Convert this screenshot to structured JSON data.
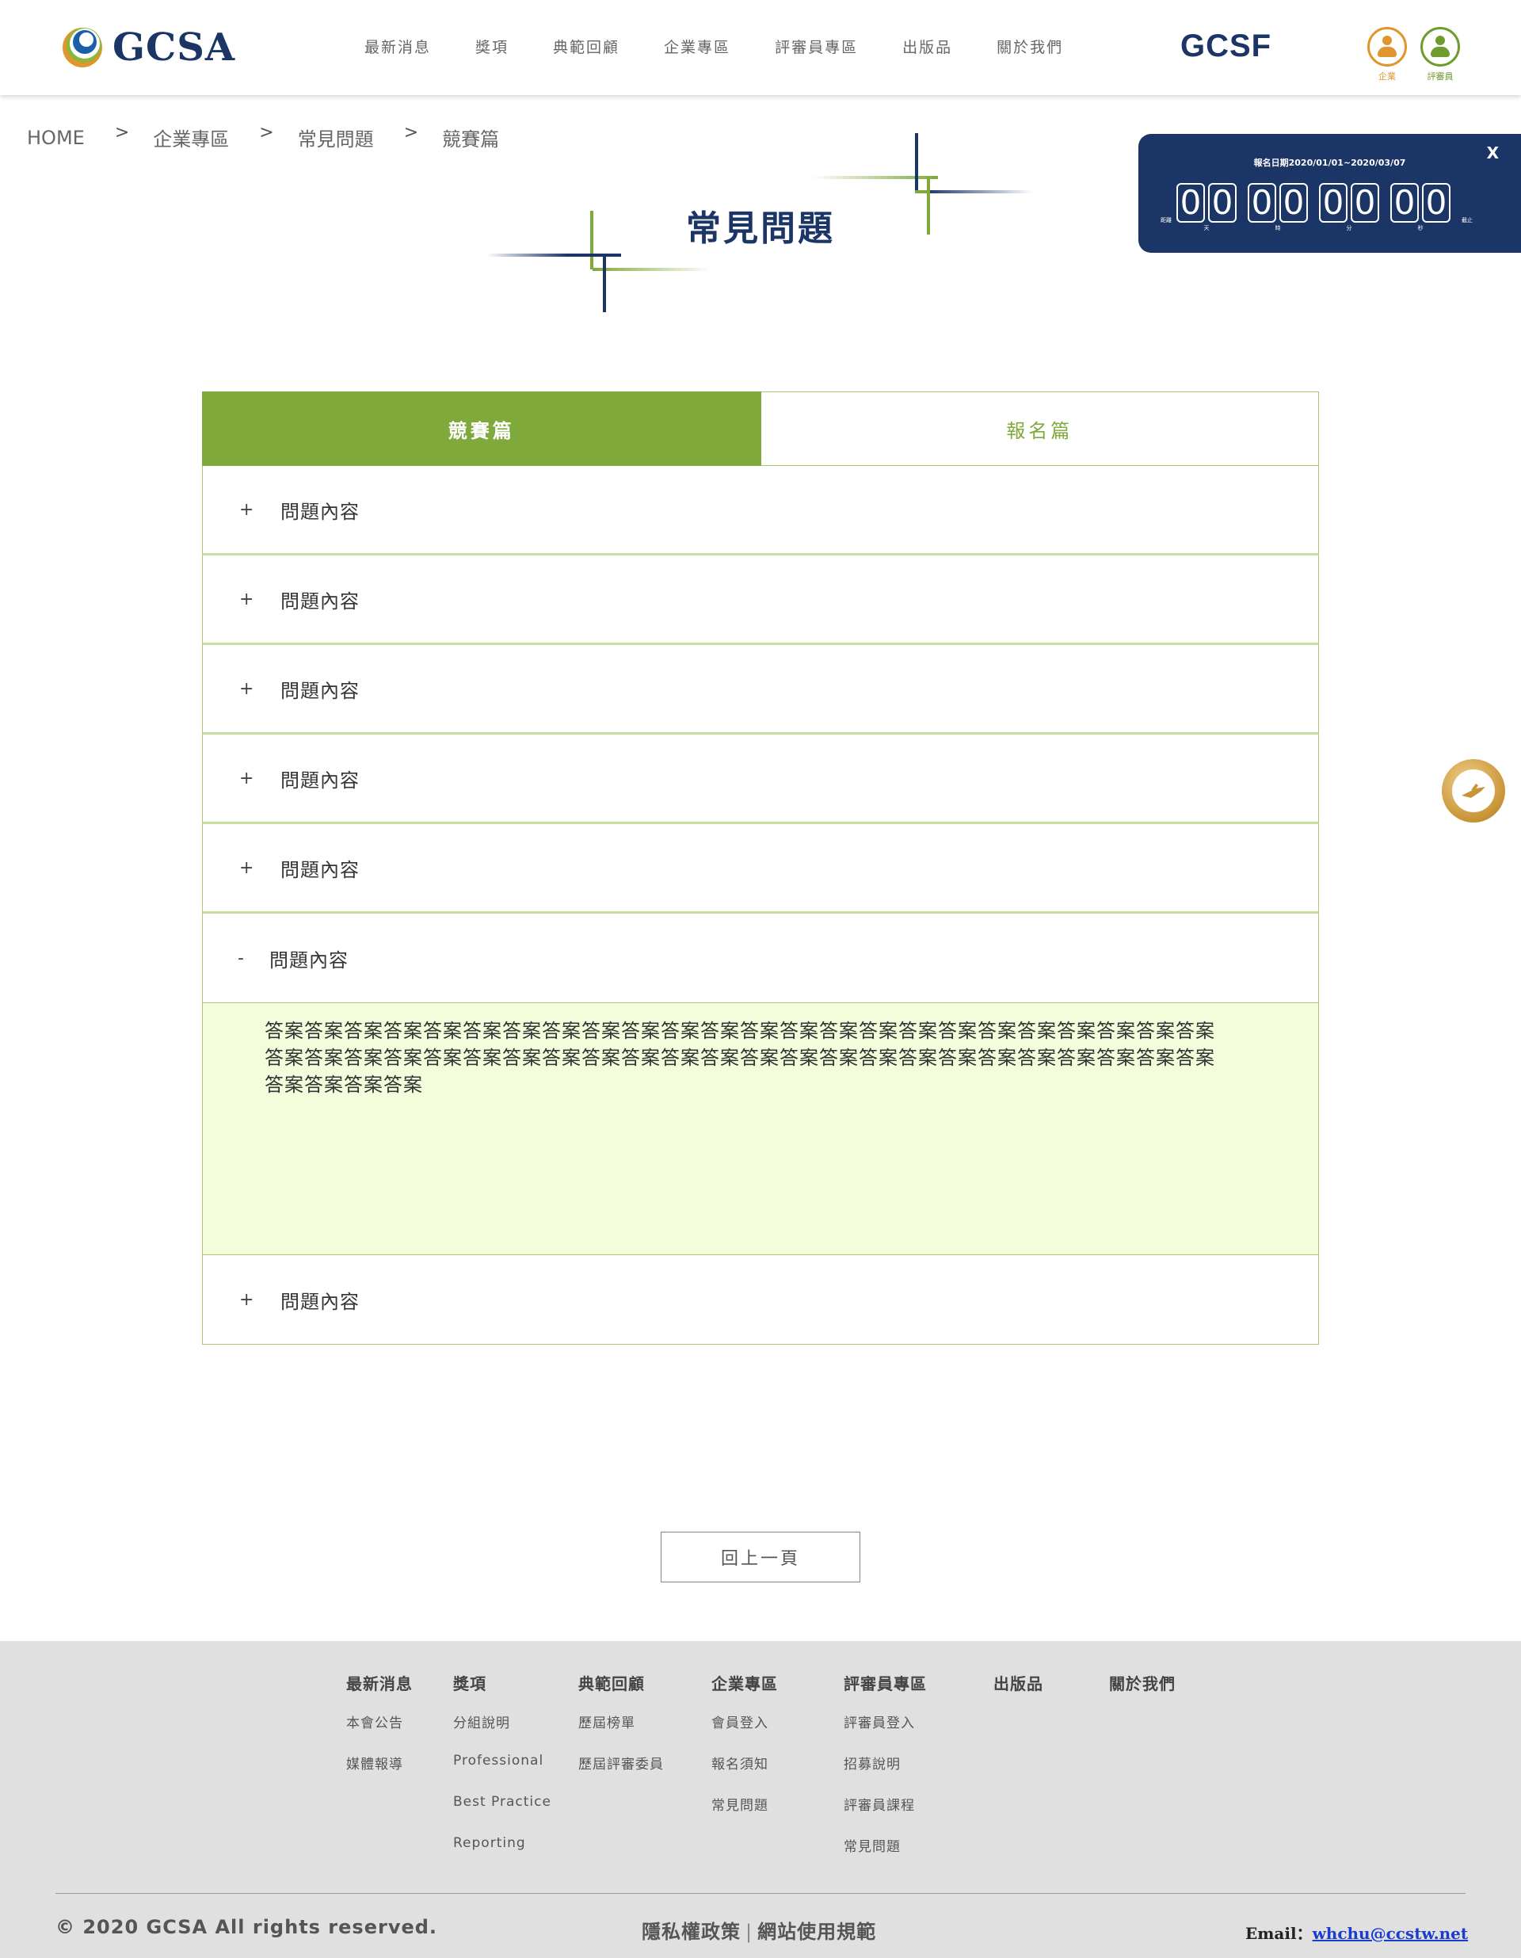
{
  "header": {
    "logo_text": "GCSA",
    "nav": [
      "最新消息",
      "獎項",
      "典範回顧",
      "企業專區",
      "評審員專區",
      "出版品",
      "關於我們"
    ],
    "brand_right": "GCSF",
    "roles": {
      "enterprise": "企業",
      "judge": "評審員"
    },
    "colors": {
      "navy": "#1b3566",
      "orange": "#e0952e",
      "green": "#6e9c2e"
    }
  },
  "breadcrumb": {
    "items": [
      "HOME",
      "企業專區",
      "常見問題",
      "競賽篇"
    ],
    "separator": ">"
  },
  "page_title": "常見問題",
  "countdown": {
    "date_range": "報名日期2020/01/01~2020/03/07",
    "close": "X",
    "left_label": "距離",
    "right_label": "截止",
    "groups": [
      {
        "digits": [
          "0",
          "0"
        ],
        "unit": "天"
      },
      {
        "digits": [
          "0",
          "0"
        ],
        "unit": "時"
      },
      {
        "digits": [
          "0",
          "0"
        ],
        "unit": "分"
      },
      {
        "digits": [
          "0",
          "0"
        ],
        "unit": "秒"
      }
    ]
  },
  "tabs": [
    {
      "label": "競賽篇",
      "active": true
    },
    {
      "label": "報名篇",
      "active": false
    }
  ],
  "faq": {
    "items": [
      {
        "sign": "+",
        "question": "問題內容"
      },
      {
        "sign": "+",
        "question": "問題內容"
      },
      {
        "sign": "+",
        "question": "問題內容"
      },
      {
        "sign": "+",
        "question": "問題內容"
      },
      {
        "sign": "+",
        "question": "問題內容"
      },
      {
        "sign": "-",
        "question": "問題內容",
        "answer": "答案答案答案答案答案答案答案答案答案答案答案答案答案答案答案答案答案答案答案答案答案答案答案答案答案答案答案答案答案答案答案答案答案答案答案答案答案答案答案答案答案答案答案答案答案答案答案答案答案答案答案答案"
      },
      {
        "sign": "+",
        "question": "問題內容"
      }
    ]
  },
  "back_button": "回上一頁",
  "footer": {
    "columns": [
      {
        "title": "最新消息",
        "links": [
          "本會公告",
          "媒體報導"
        ]
      },
      {
        "title": "獎項",
        "links": [
          "分組說明",
          "Professional",
          "Best Practice",
          "Reporting"
        ]
      },
      {
        "title": "典範回顧",
        "links": [
          "歷屆榜單",
          "歷屆評審委員"
        ]
      },
      {
        "title": "企業專區",
        "links": [
          "會員登入",
          "報名須知",
          "常見問題"
        ]
      },
      {
        "title": "評審員專區",
        "links": [
          "評審員登入",
          "招募說明",
          "評審員課程",
          "常見問題"
        ]
      },
      {
        "title": "出版品",
        "links": []
      },
      {
        "title": "關於我們",
        "links": []
      }
    ],
    "copyright": "© 2020 GCSA All rights reserved.",
    "privacy": "隱私權政策",
    "policy_separator": "|",
    "terms": "網站使用規範",
    "email_label": "Email：",
    "email": "whchu@ccstw.net"
  }
}
